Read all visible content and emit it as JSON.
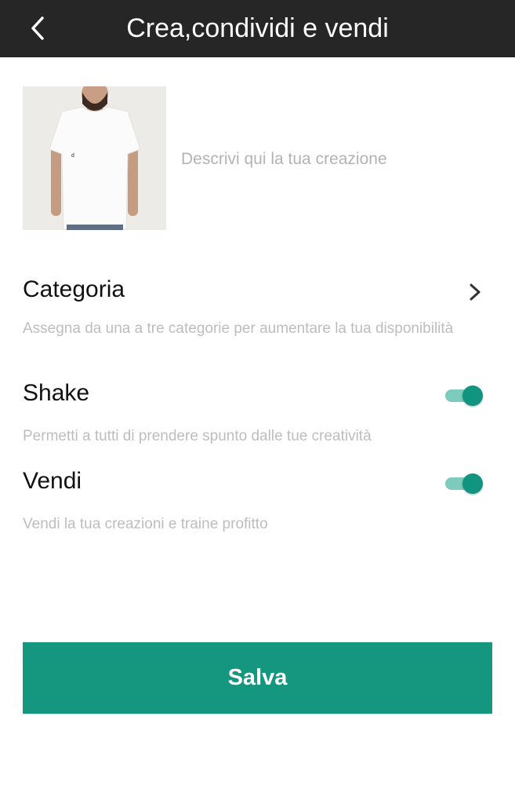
{
  "header": {
    "title": "Crea,condividi e vendi",
    "back_icon": "chevron-left-icon"
  },
  "creation": {
    "photo": "white-tshirt-model-photo",
    "description_placeholder": "Descrivi qui la tua creazione",
    "description_value": ""
  },
  "settings": {
    "category": {
      "title": "Categoria",
      "description": "Assegna da una a tre categorie per aumentare la tua disponibilità",
      "icon": "chevron-right-icon"
    },
    "shake": {
      "title": "Shake",
      "description": "Permetti a tutti di prendere spunto dalle tue creatività",
      "enabled": true
    },
    "sell": {
      "title": "Vendi",
      "description": "Vendi la tua creazioni e traine profitto",
      "enabled": true
    }
  },
  "actions": {
    "save_label": "Salva"
  },
  "colors": {
    "app_bar": "#262626",
    "accent": "#14967f",
    "toggle_track": "#7ccbbd",
    "toggle_thumb": "#129580",
    "secondary_text": "#bdbdbd"
  }
}
